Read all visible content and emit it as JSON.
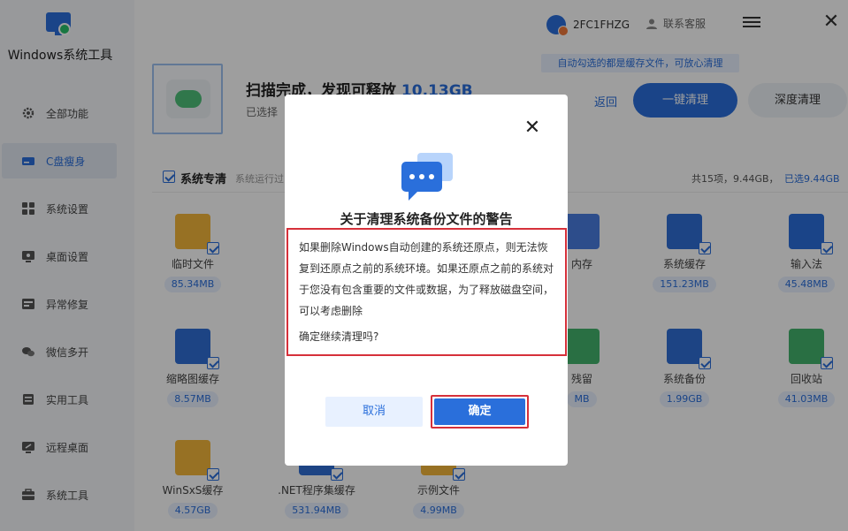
{
  "app": {
    "title": "Windows系统工具"
  },
  "sidebar": {
    "items": [
      {
        "label": "全部功能",
        "icon": "gear-icon"
      },
      {
        "label": "C盘瘦身",
        "icon": "disk-icon",
        "active": true
      },
      {
        "label": "系统设置",
        "icon": "grid-icon"
      },
      {
        "label": "桌面设置",
        "icon": "desktop-icon"
      },
      {
        "label": "异常修复",
        "icon": "wrench-icon"
      },
      {
        "label": "微信多开",
        "icon": "chat-icon"
      },
      {
        "label": "实用工具",
        "icon": "toolbox-icon"
      },
      {
        "label": "远程桌面",
        "icon": "remote-icon"
      },
      {
        "label": "系统工具",
        "icon": "briefcase-icon"
      }
    ]
  },
  "topbar": {
    "user_name": "2FC1FHZG",
    "service_label": "联系客服",
    "tip": "自动勾选的都是缓存文件，可放心清理"
  },
  "scan": {
    "title_prefix": "扫描完成，发现可释放",
    "title_size": "10.13GB",
    "subtitle": "已选择",
    "back_label": "返回",
    "clean_label": "一键清理",
    "deep_label": "深度清理"
  },
  "section": {
    "title": "系统专清",
    "desc": "系统运行过",
    "total": "共15项，9.44GB，",
    "selected": "已选9.44GB"
  },
  "files": [
    {
      "name": "临时文件",
      "size": "85.34MB",
      "color": "#f4b63a"
    },
    {
      "name": "内存",
      "size": "",
      "color": "#4a7de0"
    },
    {
      "name": "系统缓存",
      "size": "151.23MB",
      "color": "#2f6fd6"
    },
    {
      "name": "输入法",
      "size": "45.48MB",
      "color": "#2a6fdb"
    },
    {
      "name": "缩略图缓存",
      "size": "8.57MB",
      "color": "#2f6fd6"
    },
    {
      "name": "残留",
      "size": "MB",
      "color": "#43b46c"
    },
    {
      "name": "系统备份",
      "size": "1.99GB",
      "color": "#2f6fd6"
    },
    {
      "name": "回收站",
      "size": "41.03MB",
      "color": "#43b46c"
    },
    {
      "name": "WinSxS缓存",
      "size": "4.57GB",
      "color": "#f4b63a"
    },
    {
      "name": ".NET程序集缓存",
      "size": "531.94MB",
      "color": "#2f6fd6"
    },
    {
      "name": "示例文件",
      "size": "4.99MB",
      "color": "#f4b63a"
    }
  ],
  "modal": {
    "title": "关于清理系统备份文件的警告",
    "body": "如果删除Windows自动创建的系统还原点，则无法恢复到还原点之前的系统环境。如果还原点之前的系统对于您没有包含重要的文件或数据，为了释放磁盘空间，可以考虑删除",
    "question": "确定继续清理吗?",
    "cancel_label": "取消",
    "ok_label": "确定"
  },
  "colors": {
    "accent": "#2a6fdb",
    "warning_outline": "#d6303a"
  }
}
